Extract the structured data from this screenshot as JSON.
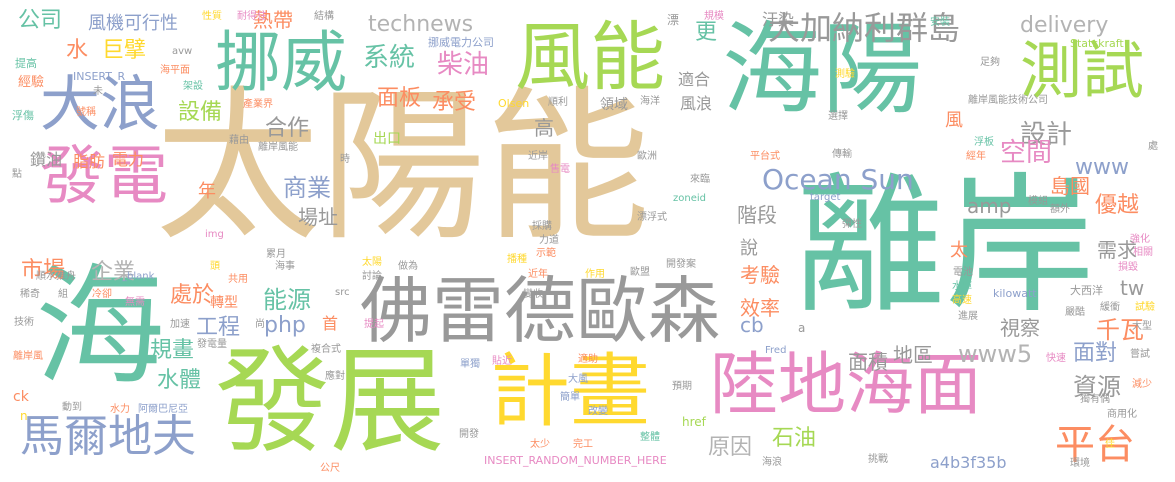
{
  "palette": {
    "tan": "#e3c89a",
    "teal": "#66c2a5",
    "green": "#a6d854",
    "orange": "#fc8d62",
    "blue": "#8da0cb",
    "pink": "#e78ac3",
    "yellow": "#ffd92f",
    "gray": "#b3b3b3",
    "dgray": "#999999"
  },
  "words": {
    "w1": "太陽能",
    "w2": "離岸",
    "w3": "海陽",
    "w4": "海",
    "w5": "發展",
    "w6": "佛雷德歐森",
    "w7": "計畫",
    "w8": "陸地海面",
    "w9": "風能",
    "w10": "挪威",
    "w11": "發電",
    "w12": "測試",
    "w13": "大浪",
    "w14": "馬爾地夫",
    "w15": "平台",
    "w16": "大加納利群島",
    "w17": "Ocean Sun",
    "w18": "系統",
    "w19": "柴油",
    "w20": "technews",
    "w21": "delivery",
    "w22": "公司",
    "w23": "風機可行性",
    "w24": "熱帶",
    "w25": "水",
    "w26": "巨擘",
    "w27": "設計",
    "w28": "空間",
    "w29": "www",
    "w30": "面板",
    "w31": "承受",
    "w32": "合作",
    "w33": "設備",
    "w34": "商業",
    "w35": "場址",
    "w36": "市場",
    "w37": "企業",
    "w38": "能源",
    "w39": "工程",
    "w40": "php",
    "w41": "規畫",
    "w42": "水體",
    "w43": "處於",
    "w44": "www5",
    "w45": "資源",
    "w46": "面對",
    "w47": "千瓦",
    "w48": "石油",
    "w49": "原因",
    "w50": "amp",
    "w51": "島國",
    "w52": "優越",
    "w53": "需求",
    "w54": "階段",
    "w55": "考驗",
    "w56": "效率",
    "w57": "視察",
    "w58": "面積",
    "w59": "地區",
    "w60": "cb",
    "w61": "tw",
    "w62": "高",
    "w63": "出口",
    "w64": "鑽油",
    "w65": "脂肪",
    "w66": "電力",
    "w67": "年",
    "w68": "轉型",
    "w69": "汙染",
    "w70": "更",
    "w71": "適合",
    "w72": "風浪",
    "w73": "領域",
    "w74": "說",
    "w75": "首",
    "w76": "a4b3f35b",
    "w77": "INSERT_RANDOM_NUMBER_HERE",
    "w78": "href",
    "w79": "挪威電力公司",
    "w80": "Statskraft",
    "w81": "kilowatt",
    "w82": "大西洋",
    "w83": "離岸風能技術公司",
    "w84": "Olsen",
    "w85": "zoneid",
    "w86": "Fred",
    "w87": "target",
    "w88": "_blank",
    "w89": "INSERT_R",
    "w90": "avw",
    "w91": "img",
    "w92": "src",
    "w93": "ck",
    "w94": "n",
    "w95": "提高",
    "w96": "經驗",
    "w97": "浮傷",
    "w98": "海平面",
    "w99": "架設",
    "w100": "號稱",
    "w101": "性質",
    "w102": "耐得住",
    "w103": "結構",
    "w104": "漂",
    "w105": "規模",
    "w106": "安裝",
    "w107": "足夠",
    "w108": "測驗",
    "w109": "選擇",
    "w110": "傳輸",
    "w111": "浮板",
    "w112": "經年",
    "w113": "處",
    "w114": "模組",
    "w115": "額外",
    "w116": "電池",
    "w117": "水庫",
    "w118": "高速",
    "w119": "進展",
    "w120": "嚴酷",
    "w121": "緩衝",
    "w122": "嘗試",
    "w123": "快速",
    "w124": "商用化",
    "w125": "獨有偶",
    "w126": "環境",
    "w127": "挑戰",
    "w128": "佳",
    "w129": "減少",
    "w130": "大型",
    "w131": "試驗",
    "w132": "損毀",
    "w133": "相關",
    "w134": "強化",
    "w135": "順水推舟",
    "w136": "稀奇",
    "w137": "組",
    "w138": "冷卻",
    "w139": "無需",
    "w140": "技術",
    "w141": "離岸風",
    "w142": "加速",
    "w143": "發電量",
    "w144": "阿爾巴尼亞",
    "w145": "水力",
    "w146": "動到",
    "w147": "公尺",
    "w148": "太少",
    "w149": "完工",
    "w150": "整體",
    "w151": "海浪",
    "w152": "改變",
    "w153": "簡單",
    "w154": "單獨",
    "w155": "大風",
    "w156": "適助",
    "w157": "開發",
    "w158": "應對",
    "w159": "複合式",
    "w160": "提起",
    "w161": "海事",
    "w162": "做為",
    "w163": "討論",
    "w164": "太陽",
    "w165": "累月",
    "w166": "共用",
    "w167": "頭",
    "w168": "尚",
    "w169": "近年",
    "w170": "作用",
    "w171": "歐盟",
    "w172": "開發案",
    "w173": "示範",
    "w174": "力道",
    "w175": "漂浮式",
    "w176": "採購",
    "w177": "來臨",
    "w178": "歐洲",
    "w179": "售電",
    "w180": "近岸",
    "w181": "順利",
    "w182": "海洋",
    "w183": "產業界",
    "w184": "時",
    "w185": "藉由",
    "w186": "離岸風能",
    "w187": "點",
    "w188": "未",
    "w189": "平台式",
    "w190": "預期",
    "w191": "貼近",
    "w192": "變收",
    "w193": "彈性",
    "w194": "播種",
    "w195": "太",
    "w196": "風",
    "w197": "a"
  }
}
